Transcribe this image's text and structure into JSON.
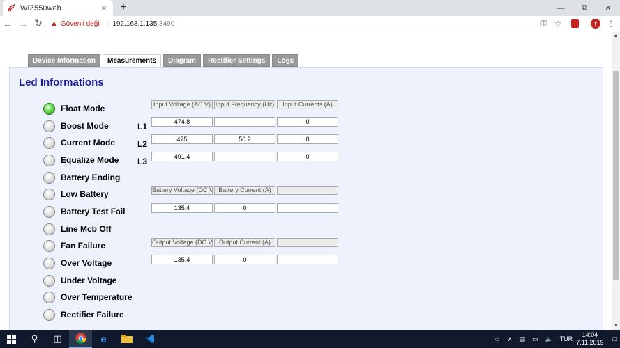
{
  "browser": {
    "tab_title": "WIZ550web",
    "tab_close": "×",
    "new_tab": "+",
    "insecure_label": "Güvenli değil",
    "url_host": "192.168.1.135",
    "url_port": ":3490",
    "profile_initial": "f"
  },
  "nav_tabs": [
    {
      "label": "Device Information"
    },
    {
      "label": "Measurements"
    },
    {
      "label": "Diagram"
    },
    {
      "label": "Rectifier Settings"
    },
    {
      "label": "Logs"
    }
  ],
  "active_tab": "Measurements",
  "panel": {
    "title": "Led Informations"
  },
  "leds": [
    {
      "label": "Float Mode",
      "on": true
    },
    {
      "label": "Boost Mode",
      "on": false
    },
    {
      "label": "Current Mode",
      "on": false
    },
    {
      "label": "Equalize Mode",
      "on": false
    },
    {
      "label": "Battery Ending",
      "on": false
    },
    {
      "label": "Low Battery",
      "on": false
    },
    {
      "label": "Battery Test Fail",
      "on": false
    },
    {
      "label": "Line Mcb Off",
      "on": false
    },
    {
      "label": "Fan Failure",
      "on": false
    },
    {
      "label": "Over Voltage",
      "on": false
    },
    {
      "label": "Under Voltage",
      "on": false
    },
    {
      "label": "Over Temperature",
      "on": false
    },
    {
      "label": "Rectifier Failure",
      "on": false
    }
  ],
  "colors": {
    "led_on": "#4cc63b",
    "title": "#1a1aa0",
    "panel_bg": "#eef2fc",
    "tab_inactive": "#999999"
  },
  "input_table": {
    "headers": [
      "Input Voltage (AC V)",
      "Input Frequency (Hz)",
      "Input Currents (A)"
    ],
    "rows": [
      {
        "phase": "L1",
        "values": [
          "474.8",
          "",
          "0"
        ]
      },
      {
        "phase": "L2",
        "values": [
          "475",
          "50.2",
          "0"
        ]
      },
      {
        "phase": "L3",
        "values": [
          "491.4",
          "",
          "0"
        ]
      }
    ]
  },
  "battery_table": {
    "headers": [
      "Battery Voltage (DC V)",
      "Battery Current (A)",
      ""
    ],
    "values": [
      "135.4",
      "0",
      ""
    ]
  },
  "output_table": {
    "headers": [
      "Output Voltage (DC V)",
      "Output Current (A)",
      ""
    ],
    "values": [
      "135.4",
      "0",
      ""
    ]
  },
  "taskbar": {
    "language": "TUR",
    "time": "14:04",
    "date": "7.11.2019"
  }
}
